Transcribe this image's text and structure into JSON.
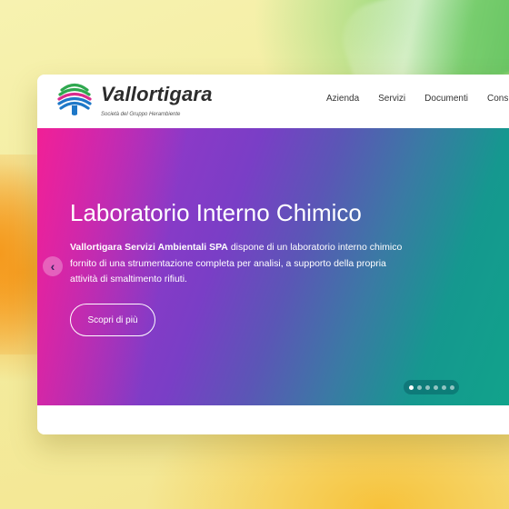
{
  "brand": {
    "name": "Vallortigara",
    "tagline": "Società del Gruppo Herambiente"
  },
  "nav": {
    "items": [
      "Azienda",
      "Servizi",
      "Documenti",
      "Consulenza"
    ]
  },
  "hero": {
    "title": "Laboratorio Interno Chimico",
    "company": "Vallortigara Servizi Ambientali SPA",
    "description": " dispone di un laboratorio interno chimico fornito di una strumentazione completa per analisi, a supporto della propria attività di smaltimento rifiuti.",
    "cta_label": "Scopri di più",
    "prev_label": "‹",
    "slides_total": 6,
    "slide_active": 1
  },
  "colors": {
    "accent_magenta": "#f02096",
    "accent_teal": "#10a58a",
    "logo_green": "#2fa84f",
    "logo_blue": "#1e78c8",
    "logo_magenta": "#d92a8c"
  },
  "icons": {
    "logo": "leaf-fan-logo-icon",
    "prev": "chevron-left-icon"
  }
}
